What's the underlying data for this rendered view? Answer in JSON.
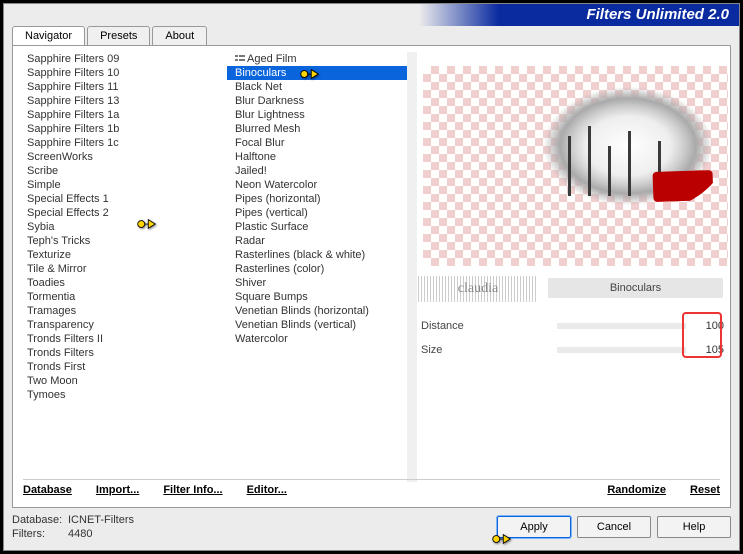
{
  "title": "Filters Unlimited 2.0",
  "tabs": {
    "navigator": "Navigator",
    "presets": "Presets",
    "about": "About"
  },
  "categories": [
    "Sapphire Filters 09",
    "Sapphire Filters 10",
    "Sapphire Filters 11",
    "Sapphire Filters 13",
    "Sapphire Filters 1a",
    "Sapphire Filters 1b",
    "Sapphire Filters 1c",
    "ScreenWorks",
    "Scribe",
    "Simple",
    "Special Effects 1",
    "Special Effects 2",
    "Sybia",
    "Teph's Tricks",
    "Texturize",
    "Tile & Mirror",
    "Toadies",
    "Tormentia",
    "Tramages",
    "Transparency",
    "Tronds Filters II",
    "Tronds Filters",
    "Tronds First",
    "Two Moon",
    "Tymoes"
  ],
  "filters": [
    "Aged Film",
    "Binoculars",
    "Black Net",
    "Blur Darkness",
    "Blur Lightness",
    "Blurred Mesh",
    "Focal Blur",
    "Halftone",
    "Jailed!",
    "Neon Watercolor",
    "Pipes (horizontal)",
    "Pipes (vertical)",
    "Plastic Surface",
    "Radar",
    "Rasterlines (black & white)",
    "Rasterlines (color)",
    "Shiver",
    "Square Bumps",
    "Venetian Blinds (horizontal)",
    "Venetian Blinds (vertical)",
    "Watercolor"
  ],
  "selected_filter_index": 1,
  "current_filter_label": "Binoculars",
  "watermark": "claudia",
  "params": [
    {
      "label": "Distance",
      "value": "100"
    },
    {
      "label": "Size",
      "value": "105"
    }
  ],
  "links": {
    "database": "Database",
    "import": "Import...",
    "filter_info": "Filter Info...",
    "editor": "Editor...",
    "randomize": "Randomize",
    "reset": "Reset"
  },
  "footer": {
    "db_label": "Database:",
    "db_value": "ICNET-Filters",
    "filters_label": "Filters:",
    "filters_value": "4480",
    "apply": "Apply",
    "cancel": "Cancel",
    "help": "Help"
  }
}
